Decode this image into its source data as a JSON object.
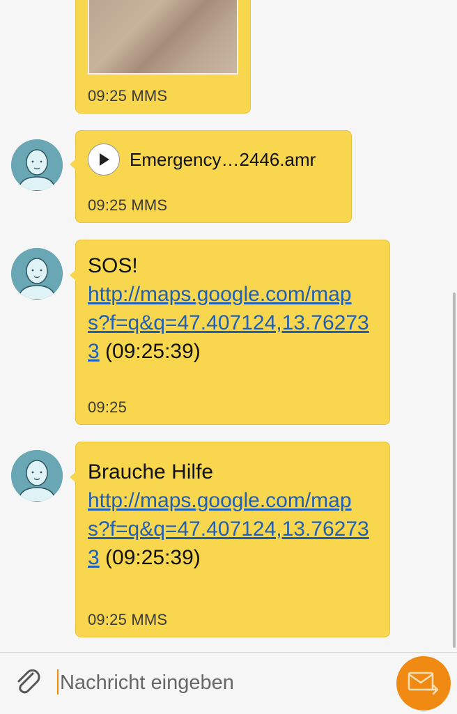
{
  "messages": [
    {
      "type": "image",
      "meta": "09:25 MMS"
    },
    {
      "type": "audio",
      "file_name": "Emergency…2446.amr",
      "meta": "09:25 MMS"
    },
    {
      "type": "text",
      "text": "SOS!",
      "link": "http://maps.google.com/maps?f=q&q=47.407124,13.762733",
      "suffix": " (09:25:39)",
      "meta": "09:25"
    },
    {
      "type": "text",
      "text": "Brauche Hilfe",
      "link": "http://maps.google.com/maps?f=q&q=47.407124,13.762733",
      "suffix": " (09:25:39)",
      "meta": "09:25 MMS"
    }
  ],
  "composer": {
    "placeholder": "Nachricht eingeben"
  },
  "icons": {
    "attach": "paperclip-icon",
    "send": "send-message-icon",
    "play": "play-icon",
    "avatar": "contact-avatar-icon"
  },
  "colors": {
    "bubble": "#f8d64e",
    "link": "#1f5fb6",
    "send_button": "#f08a12",
    "avatar_bg": "#69a7b4"
  }
}
